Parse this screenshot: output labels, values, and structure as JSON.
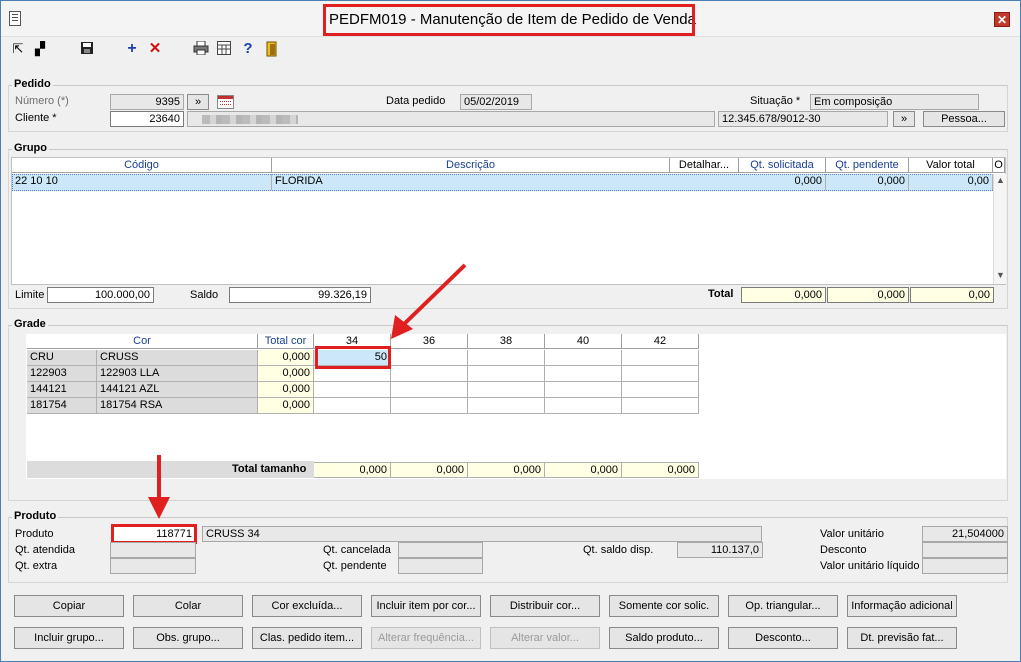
{
  "window": {
    "title": "PEDFM019 - Manutenção de Item de Pedido de Venda",
    "close": "✕"
  },
  "toolbar": {
    "icons": [
      "export-icon",
      "tile-icon",
      "save-icon",
      "add-icon",
      "delete-icon",
      "print-icon",
      "calculator-icon",
      "help-icon",
      "exit-icon"
    ]
  },
  "pedido": {
    "title": "Pedido",
    "numero_label": "Número (*)",
    "numero": "9395",
    "cliente_label": "Cliente *",
    "cliente": "23640",
    "goto": "»",
    "data_label": "Data pedido",
    "data": "05/02/2019",
    "situacao_label": "Situação *",
    "situacao": "Em composição",
    "cnpj": "12.345.678/9012-30",
    "pessoa_btn": "Pessoa..."
  },
  "grupo": {
    "title": "Grupo",
    "headers": {
      "codigo": "Código",
      "descricao": "Descrição",
      "detalhar": "Detalhar...",
      "qt_solicitada": "Qt. solicitada",
      "qt_pendente": "Qt. pendente",
      "valor_total": "Valor total",
      "o": "O"
    },
    "row": {
      "codigo": "22 10 10",
      "descricao": "FLORIDA",
      "qt_solicitada": "0,000",
      "qt_pendente": "0,000",
      "valor_total": "0,00"
    },
    "limite_label": "Limite",
    "limite": "100.000,00",
    "saldo_label": "Saldo",
    "saldo": "99.326,19",
    "total_label": "Total",
    "total_solicitada": "0,000",
    "total_pendente": "0,000",
    "total_valor": "0,00"
  },
  "grade": {
    "title": "Grade",
    "header_cor": "Cor",
    "header_total": "Total cor",
    "sizes": [
      "34",
      "36",
      "38",
      "40",
      "42"
    ],
    "rows": [
      {
        "code": "CRU",
        "name": "CRUSS",
        "total": "0,000",
        "v34": "50"
      },
      {
        "code": "122903",
        "name": "122903 LLA",
        "total": "0,000",
        "v34": ""
      },
      {
        "code": "144121",
        "name": "144121 AZL",
        "total": "0,000",
        "v34": ""
      },
      {
        "code": "181754",
        "name": "181754 RSA",
        "total": "0,000",
        "v34": ""
      }
    ],
    "total_tamanho_label": "Total tamanho",
    "totals": [
      "0,000",
      "0,000",
      "0,000",
      "0,000",
      "0,000"
    ]
  },
  "produto": {
    "title": "Produto",
    "produto_label": "Produto",
    "produto": "118771",
    "produto_desc": "CRUSS 34",
    "qt_atendida_label": "Qt. atendida",
    "qt_extra_label": "Qt. extra",
    "qt_cancelada_label": "Qt. cancelada",
    "qt_pendente_label": "Qt. pendente",
    "qt_saldo_label": "Qt. saldo disp.",
    "qt_saldo": "110.137,0",
    "valor_unitario_label": "Valor unitário",
    "valor_unitario": "21,504000",
    "desconto_label": "Desconto",
    "valor_liquido_label": "Valor unitário líquido"
  },
  "buttons": {
    "copiar": "Copiar",
    "colar": "Colar",
    "cor_excluida": "Cor excluída...",
    "incluir_item_cor": "Incluir item por cor...",
    "distribuir_cor": "Distribuir cor...",
    "somente_cor": "Somente cor solic.",
    "op_triangular": "Op. triangular...",
    "info_adicional": "Informação adicional",
    "incluir_grupo": "Incluir grupo...",
    "obs_grupo": "Obs. grupo...",
    "clas_pedido": "Clas. pedido item...",
    "alterar_freq": "Alterar frequência...",
    "alterar_valor": "Alterar valor...",
    "saldo_produto": "Saldo produto...",
    "desconto": "Desconto...",
    "dt_previsao": "Dt. previsão fat..."
  },
  "colors": {
    "highlight": "#e02020",
    "yellow_field": "#ffffe4",
    "selection": "#cce8f8",
    "header_text": "#1a3f8f"
  }
}
